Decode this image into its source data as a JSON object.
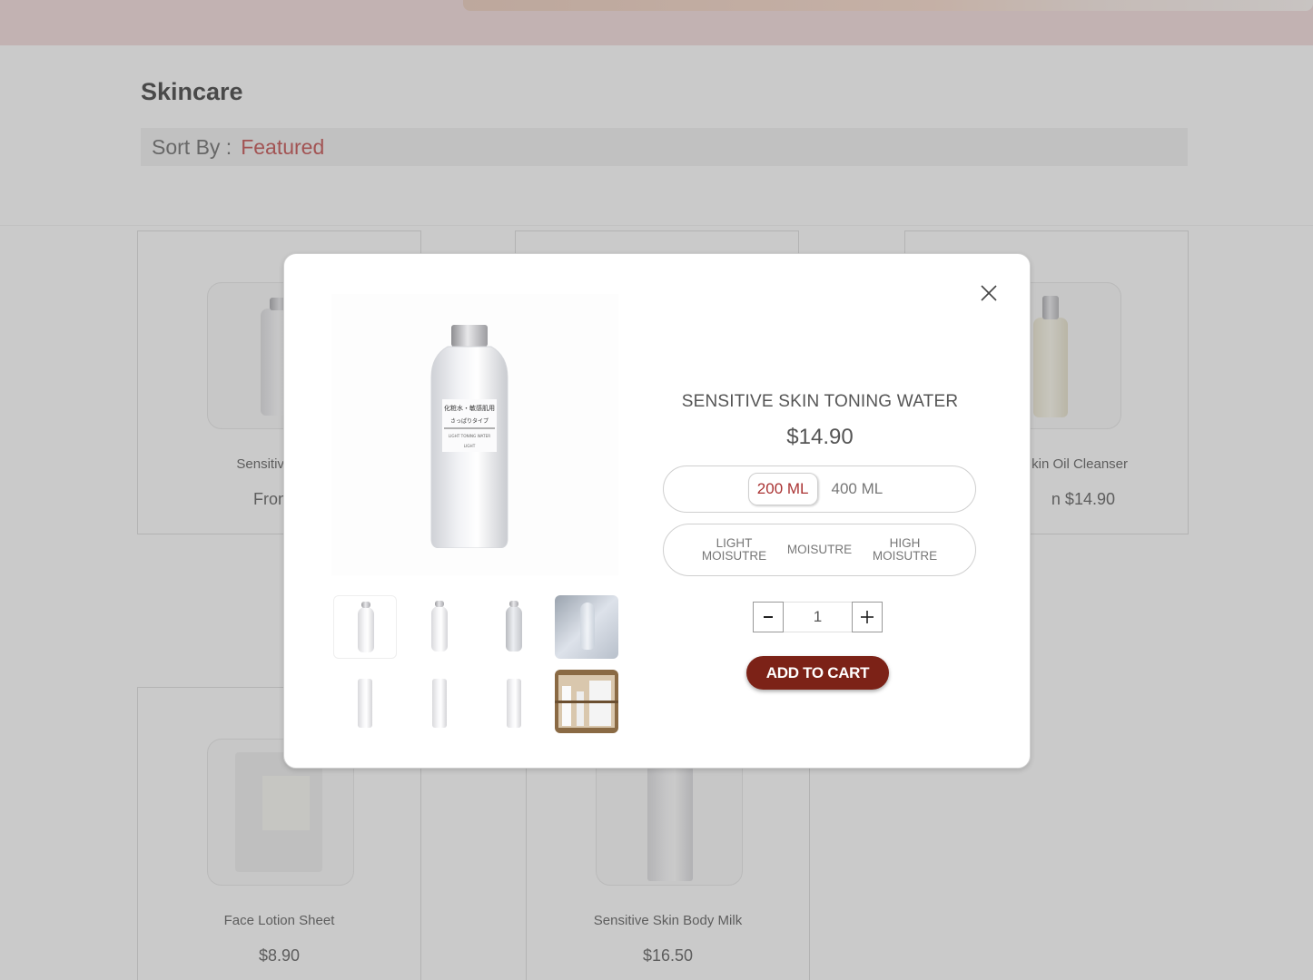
{
  "page": {
    "title": "Skincare",
    "sort_label": "Sort By :",
    "sort_value": "Featured"
  },
  "products": [
    {
      "name": "Sensitive Skin",
      "price": "From $"
    },
    {
      "name": "kin Oil Cleanser",
      "price": "n $14.90"
    },
    {
      "name": "Face Lotion Sheet",
      "price": "$8.90"
    },
    {
      "name": "Sensitive Skin Body Milk",
      "price": "$16.50"
    }
  ],
  "modal": {
    "title": "SENSITIVE SKIN TONING WATER",
    "price": "$14.90",
    "sizes": [
      "200 ML",
      "400 ML"
    ],
    "selected_size": "200 ML",
    "types": [
      {
        "line1": "LIGHT",
        "line2": "MOISUTRE"
      },
      {
        "line1": "MOISUTRE",
        "line2": ""
      },
      {
        "line1": "HIGH",
        "line2": "MOISUTRE"
      }
    ],
    "quantity": "1",
    "decrement": "−",
    "increment": "+",
    "add_to_cart": "ADD TO CART",
    "bottle_label": {
      "line1": "化粧水・敏感肌用",
      "line2": "さっぱりタイプ",
      "line3": "LIGHT TONING WATER",
      "line4": "LIGHT"
    }
  },
  "colors": {
    "accent": "#7c2217",
    "sort_accent": "#b33333",
    "hero": "#f1d6d6"
  },
  "icons": {
    "close": "close-icon",
    "minus": "minus-icon",
    "plus": "plus-icon"
  }
}
